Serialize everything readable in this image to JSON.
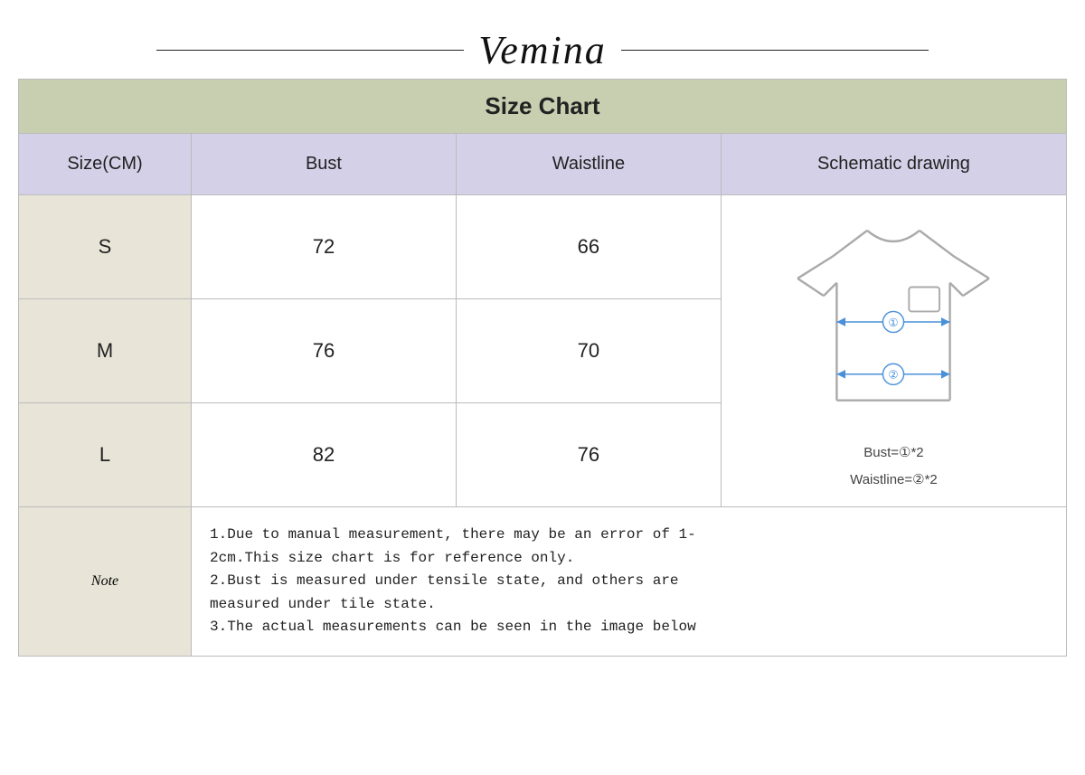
{
  "brand": {
    "name": "Vemina"
  },
  "table": {
    "header": "Size Chart",
    "columns": {
      "size": "Size(CM)",
      "bust": "Bust",
      "waistline": "Waistline",
      "schematic": "Schematic drawing"
    },
    "rows": [
      {
        "size": "S",
        "bust": "72",
        "waistline": "66"
      },
      {
        "size": "M",
        "bust": "76",
        "waistline": "70"
      },
      {
        "size": "L",
        "bust": "82",
        "waistline": "76"
      }
    ],
    "note": {
      "label": "Note",
      "lines": [
        "1.Due to manual measurement, there may be an error of 1-",
        "2cm.This size chart is for reference only.",
        "2.Bust is measured under tensile state, and others are",
        "measured under tile state.",
        "3.The actual measurements can be seen in the image below"
      ]
    }
  },
  "schematic": {
    "formula1": "Bust=①*2",
    "formula2": "Waistline=②*2"
  }
}
